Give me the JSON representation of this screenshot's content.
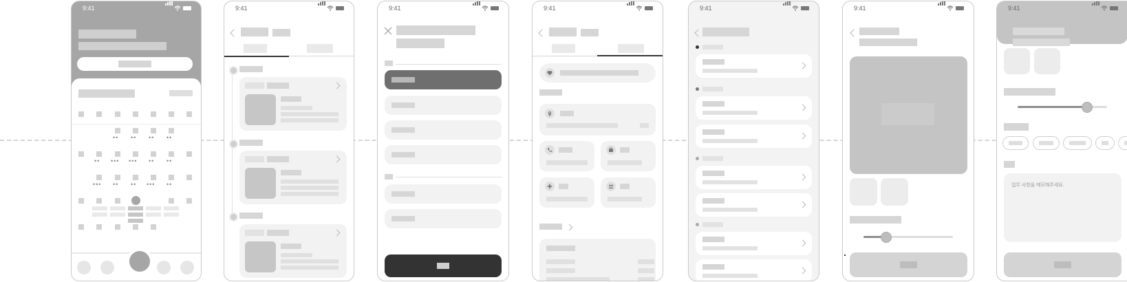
{
  "status_bar": {
    "time": "9:41"
  },
  "screen7": {
    "memo_placeholder": "업무 사항을 메모해주세요."
  },
  "colors": {
    "placeholder": "#d6d6d6",
    "card": "#f2f2f2",
    "header_fill": "#a6a6a6",
    "selected_option": "#6f6f6f",
    "primary_button": "#333333"
  },
  "icons": [
    "signal-icon",
    "wifi-icon",
    "battery-icon",
    "back-icon",
    "close-icon",
    "chevron-right-icon",
    "heart-icon",
    "location-pin-icon",
    "phone-icon",
    "briefcase-icon",
    "plus-icon",
    "people-icon"
  ]
}
